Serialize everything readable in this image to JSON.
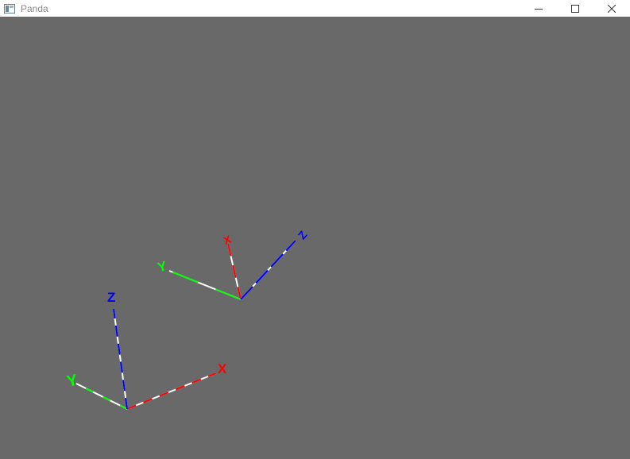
{
  "window": {
    "title": "Panda",
    "app_icon": "panda-window-icon",
    "controls": [
      "minimize-icon",
      "maximize-icon",
      "close-icon"
    ]
  },
  "viewport": {
    "background_color": "#696969",
    "axis_colors": {
      "x": "#ff0000",
      "y": "#00ff00",
      "z": "#0000ff",
      "base": "#ffffff"
    },
    "gizmos": [
      {
        "name": "world-axes",
        "labels": {
          "x": "X",
          "y": "Y",
          "z": "Z"
        }
      },
      {
        "name": "object-axes",
        "labels": {
          "x": "X",
          "y": "Y",
          "z": "Z"
        }
      }
    ]
  }
}
